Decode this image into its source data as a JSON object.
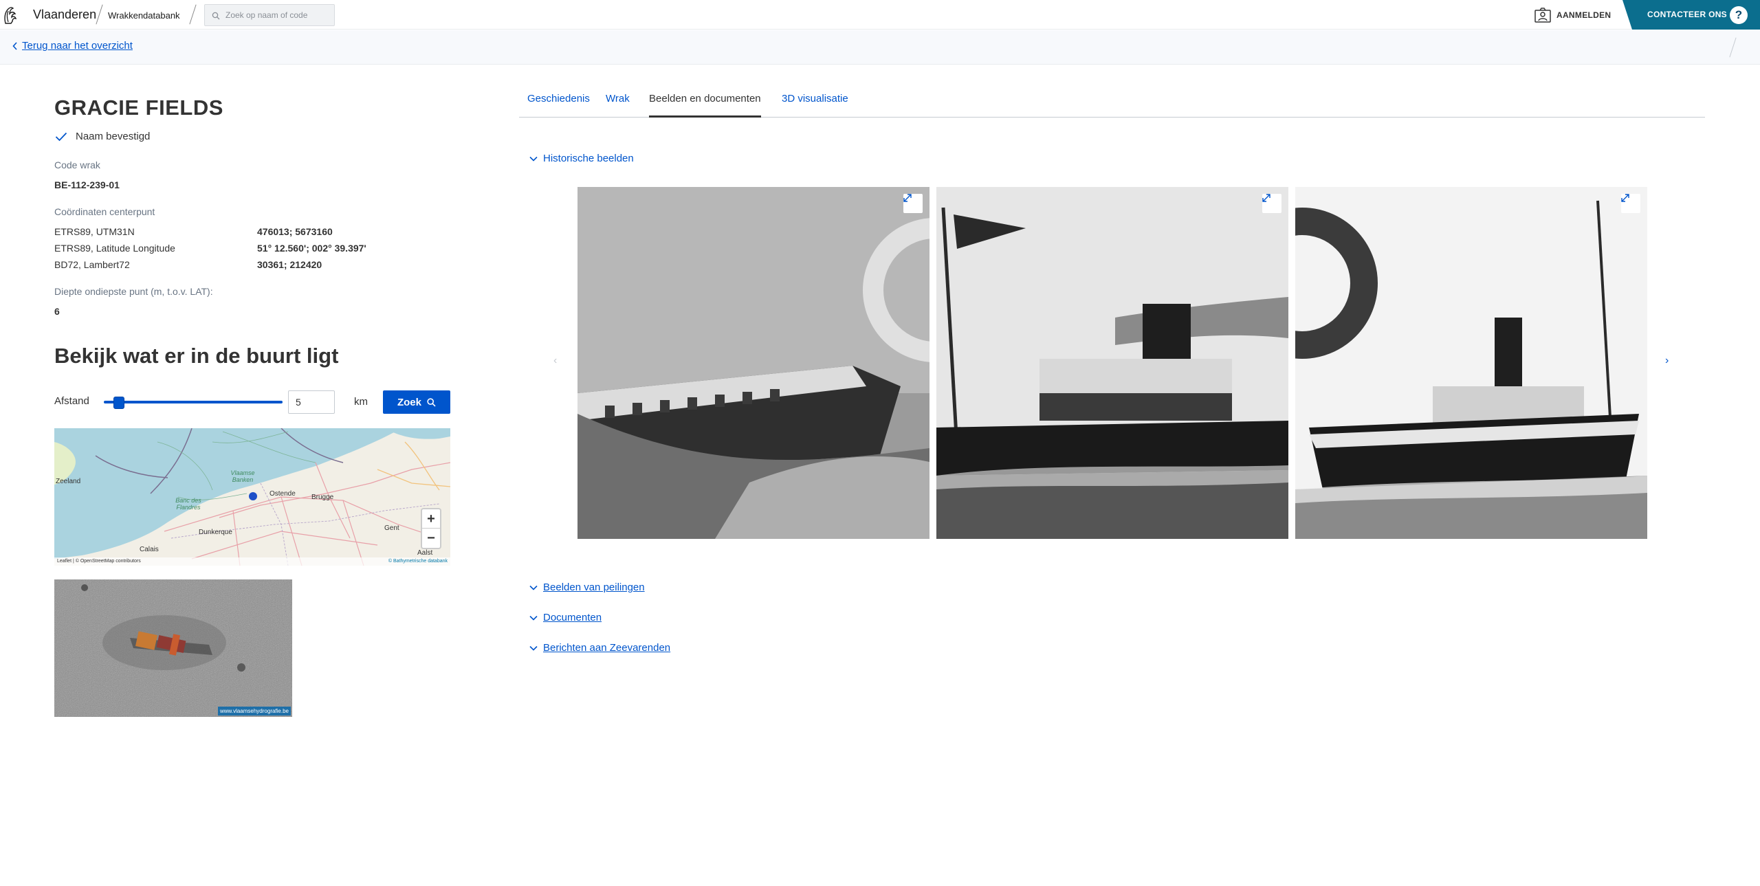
{
  "header": {
    "brand": "Vlaanderen",
    "app": "Wrakkendatabank",
    "search_placeholder": "Zoek op naam of code",
    "login": "AANMELDEN",
    "contact": "CONTACTEER ONS",
    "help": "?"
  },
  "nav": {
    "back": "Terug naar het overzicht"
  },
  "wreck": {
    "name": "GRACIE FIELDS",
    "name_status": "Naam bevestigd",
    "code_label": "Code wrak",
    "code": "BE-112-239-01",
    "coords_label": "Coördinaten centerpunt",
    "coords": [
      {
        "system": "ETRS89, UTM31N",
        "value": "476013; 5673160"
      },
      {
        "system": "ETRS89, Latitude Longitude",
        "value": "51° 12.560'; 002° 39.397'"
      },
      {
        "system": "BD72, Lambert72",
        "value": "30361; 212420"
      }
    ],
    "depth_label": "Diepte ondiepste punt (m, t.o.v. LAT):",
    "depth": "6"
  },
  "nearby": {
    "title": "Bekijk wat er in de buurt ligt",
    "distance_label": "Afstand",
    "distance_value": "5",
    "unit": "km",
    "search_button": "Zoek"
  },
  "map": {
    "places": [
      "Ostende",
      "Brugge",
      "Dunkerque",
      "Calais",
      "Gent",
      "Aalst",
      "Vlaamse Banken",
      "Banc des Flandres",
      "Zeeland"
    ],
    "zoom_in": "+",
    "zoom_out": "−",
    "attribution_left": "Leaflet | © OpenStreetMap contributors",
    "attribution_right": "© Bathymetrische databank"
  },
  "sonar_credit": "www.vlaamsehydrografie.be",
  "tabs": [
    "Geschiedenis",
    "Wrak",
    "Beelden en documenten",
    "3D visualisatie"
  ],
  "active_tab": "Beelden en documenten",
  "sections": {
    "historical": "Historische beelden",
    "soundings": "Beelden van peilingen",
    "documents": "Documenten",
    "notices": "Berichten aan Zeevarenden"
  },
  "gallery": {
    "image_count": 3,
    "prev": "‹",
    "next": "›"
  },
  "colors": {
    "primary": "#0055cc",
    "contact_bar": "#0b6e8e",
    "text": "#333332",
    "muted": "#687483"
  }
}
